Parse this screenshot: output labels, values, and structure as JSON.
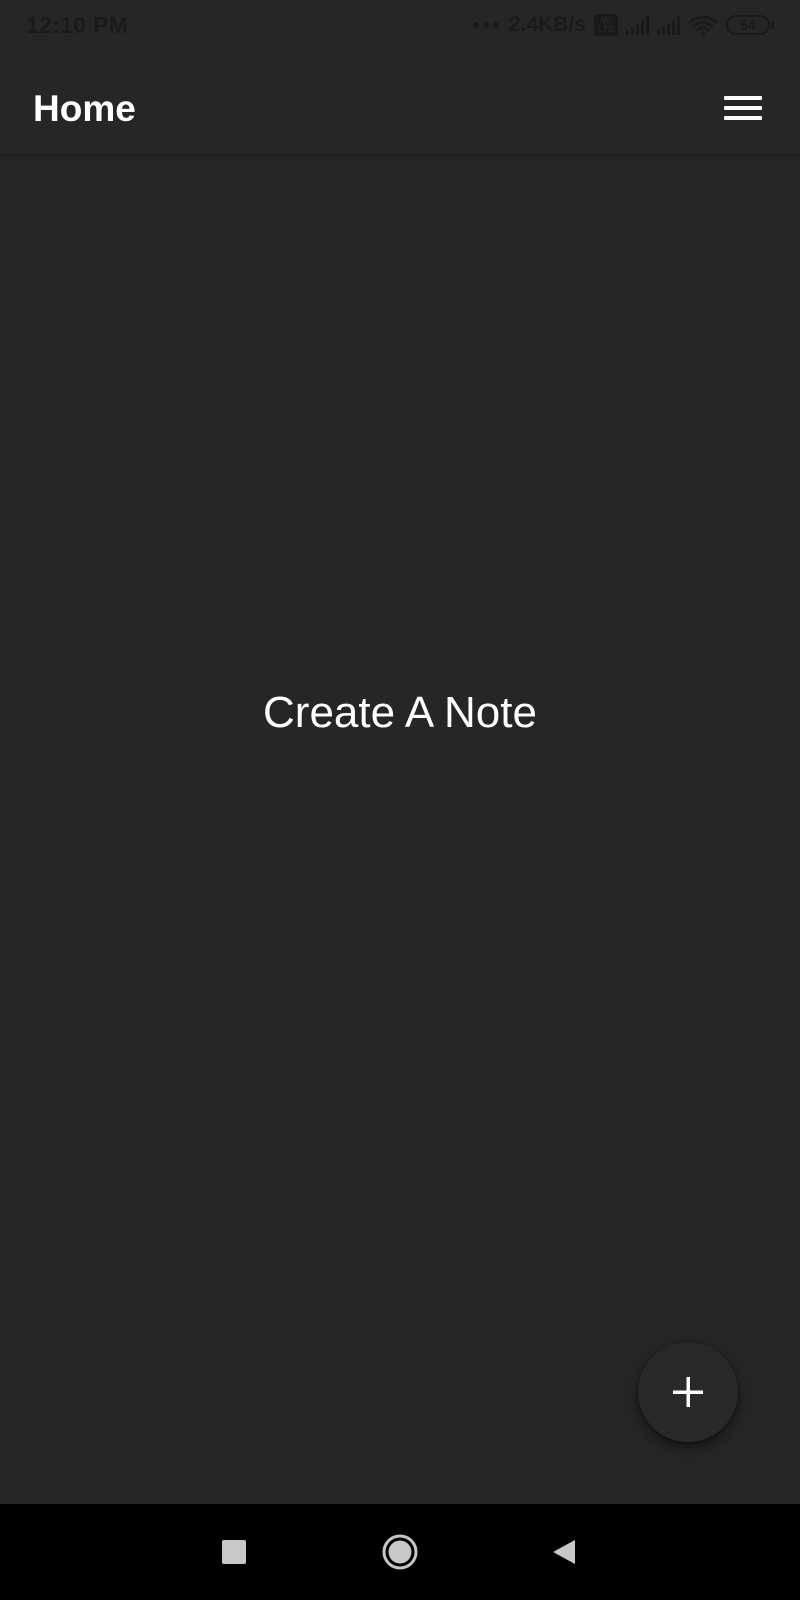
{
  "status_bar": {
    "time": "12:10 PM",
    "network_speed": "2.4KB/s",
    "volte_label": "Vo LTE",
    "battery": "54",
    "icons": [
      "signal-icon",
      "signal-icon",
      "wifi-icon",
      "battery-icon"
    ]
  },
  "app_bar": {
    "title": "Home",
    "menu_icon": "hamburger-menu-icon"
  },
  "main": {
    "empty_message": "Create A Note"
  },
  "fab": {
    "icon": "plus-icon"
  },
  "nav_bar": {
    "buttons": [
      "recents-square-icon",
      "home-circle-icon",
      "back-triangle-icon"
    ]
  },
  "colors": {
    "background": "#262626",
    "text": "#ffffff",
    "status_text": "#1a1a1a",
    "nav_background": "#000000",
    "nav_icons": "#c7c7c7"
  }
}
